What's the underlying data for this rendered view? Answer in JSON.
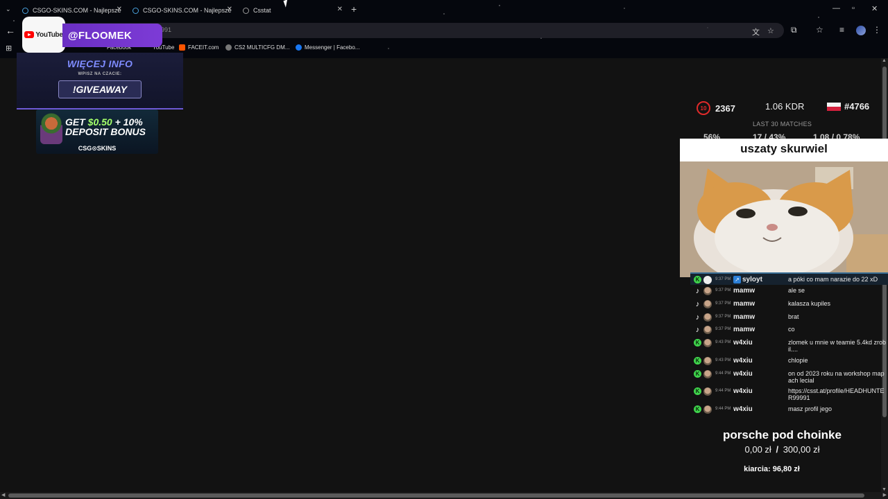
{
  "browser": {
    "tabs": [
      {
        "title": "CSGO-SKINS.COM - Najlepsze"
      },
      {
        "title": "CSGO-SKINS.COM - Najlepsze"
      },
      {
        "title": "Csstat"
      }
    ],
    "url_fragment": "991",
    "bookmarks": [
      "FACEIT.com",
      "CS2 MULTICFG DM...",
      "Messenger | Facebo..."
    ],
    "bookmark_partial": [
      "Facebook",
      "YouTube"
    ]
  },
  "overlay": {
    "youtube_label": "YouTube",
    "handle": "@FLOOMEK",
    "info_title": "WIĘCEJ INFO",
    "info_sub": "WPISZ NA CZACIE:",
    "giveaway_cmd": "!GIVEAWAY",
    "promo_line1_a": "GET ",
    "promo_line1_b": "$0.50",
    "promo_line1_c": " + 10%",
    "promo_line2": "DEPOSIT BONUS",
    "promo_brand": "CSG⊙SKINS"
  },
  "stats": {
    "level": "10",
    "elo": "2367",
    "kdr": "1.06 KDR",
    "rank": "#4766",
    "last_matches_label": "LAST 30 MATCHES",
    "winrate": "56%",
    "hs": "17 / 43%",
    "kd_pair": "1.08 / 0.78%"
  },
  "cat_widget": {
    "title": "uszaty skurwiel"
  },
  "chat": [
    {
      "platform": "kick",
      "time": "9:37 PM",
      "user": "syloyt",
      "text": "a póki co mam narazie do 22 xD",
      "sub": true
    },
    {
      "platform": "tiktok",
      "time": "9:37 PM",
      "user": "mamw",
      "text": "ale se"
    },
    {
      "platform": "tiktok",
      "time": "9:37 PM",
      "user": "mamw",
      "text": "kalasza kupiles"
    },
    {
      "platform": "tiktok",
      "time": "9:37 PM",
      "user": "mamw",
      "text": "brat"
    },
    {
      "platform": "tiktok",
      "time": "9:37 PM",
      "user": "mamw",
      "text": "co"
    },
    {
      "platform": "kick",
      "time": "9:43 PM",
      "user": "w4xiu",
      "text": "zlomek u mnie w teamie 5.4kd zrobil...."
    },
    {
      "platform": "kick",
      "time": "9:43 PM",
      "user": "w4xiu",
      "text": "chlopie"
    },
    {
      "platform": "kick",
      "time": "9:44 PM",
      "user": "w4xiu",
      "text": "on od 2023 roku na workshop mapach lecial"
    },
    {
      "platform": "kick",
      "time": "9:44 PM",
      "user": "w4xiu",
      "text": "https://csst.at/profile/HEADHUNTER99991"
    },
    {
      "platform": "kick",
      "time": "9:44 PM",
      "user": "w4xiu",
      "text": "masz profil jego"
    }
  ],
  "goal": {
    "title": "porsche pod choinke",
    "current": "0,00 zł",
    "separator": "/",
    "target": "300,00 zł",
    "kiarcia": "kiarcia: 96,80 zł"
  }
}
